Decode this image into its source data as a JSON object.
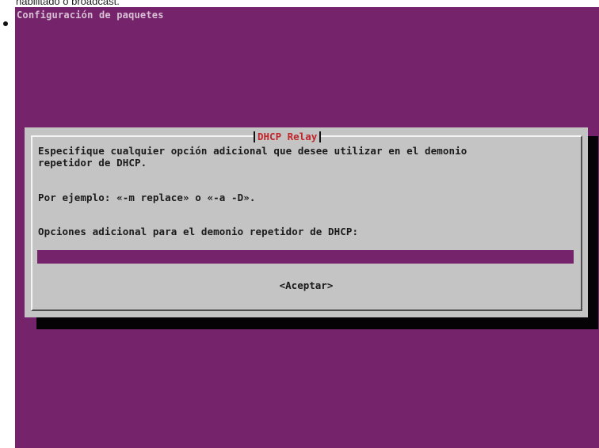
{
  "page": {
    "caption": "habilitado o broadcast."
  },
  "console": {
    "title": "Configuración de paquetes"
  },
  "dialog": {
    "title": "DHCP Relay",
    "description_line1": "Especifique cualquier opción adicional que desee utilizar en el demonio",
    "description_line2": "repetidor de DHCP.",
    "example": "Por ejemplo: «-m replace» o «-a -D».",
    "prompt": "Opciones adicional para el demonio repetidor de DHCP:",
    "input_value": "",
    "accept_button": "<Aceptar>"
  },
  "colors": {
    "background": "#75246b",
    "dialog": "#c4c4c4",
    "title_red": "#c0262b"
  }
}
